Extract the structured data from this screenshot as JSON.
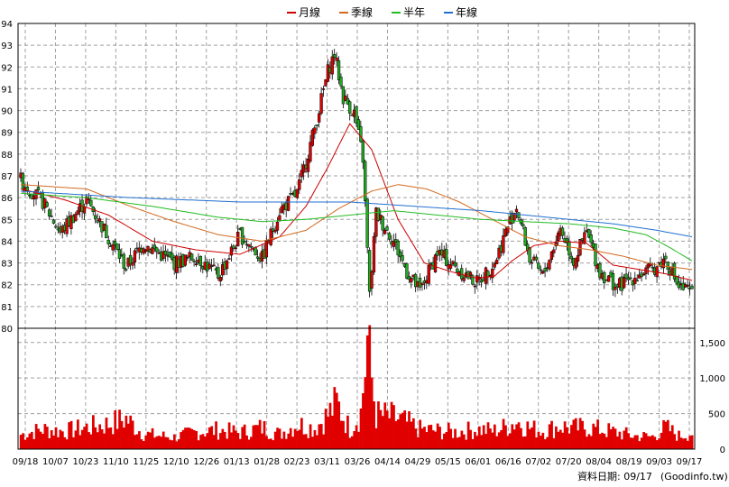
{
  "chart_data": {
    "type": "candlestick",
    "legend": [
      {
        "name": "月線",
        "color": "#cc0000"
      },
      {
        "name": "季線",
        "color": "#d2691e"
      },
      {
        "name": "半年",
        "color": "#22bb22"
      },
      {
        "name": "年線",
        "color": "#1f6fd0"
      }
    ],
    "legend_placement": "top-center",
    "grid": true,
    "price_axis": {
      "min": 80,
      "max": 94,
      "ticks": [
        "80",
        "81",
        "82",
        "83",
        "84",
        "85",
        "86",
        "87",
        "88",
        "89",
        "90",
        "91",
        "92",
        "93",
        "94"
      ]
    },
    "volume_axis": {
      "min": 0,
      "max": 1700,
      "ticks": [
        "0",
        "500",
        "1,000",
        "1,500"
      ]
    },
    "x_tick_labels": [
      "09/18",
      "10/07",
      "10/23",
      "11/10",
      "11/25",
      "12/10",
      "12/26",
      "01/13",
      "01/28",
      "02/23",
      "03/11",
      "03/26",
      "04/14",
      "04/29",
      "05/15",
      "06/01",
      "06/16",
      "07/02",
      "07/20",
      "08/04",
      "08/19",
      "09/03",
      "09/17"
    ],
    "up_color": "#dd0000",
    "down_color": "#22aa22",
    "price_anchors": [
      [
        0,
        86.8
      ],
      [
        10,
        85.8
      ],
      [
        18,
        84.4
      ],
      [
        30,
        85.9
      ],
      [
        40,
        84.2
      ],
      [
        48,
        82.8
      ],
      [
        56,
        83.9
      ],
      [
        70,
        83.0
      ],
      [
        80,
        83.3
      ],
      [
        90,
        82.4
      ],
      [
        100,
        84.3
      ],
      [
        110,
        83.2
      ],
      [
        118,
        85.4
      ],
      [
        126,
        86.2
      ],
      [
        134,
        89.2
      ],
      [
        140,
        91.8
      ],
      [
        143,
        92.6
      ],
      [
        147,
        90.6
      ],
      [
        152,
        89.9
      ],
      [
        156,
        87.8
      ],
      [
        159,
        81.5
      ],
      [
        162,
        85.3
      ],
      [
        170,
        84.0
      ],
      [
        176,
        82.6
      ],
      [
        182,
        81.7
      ],
      [
        190,
        83.5
      ],
      [
        198,
        82.8
      ],
      [
        208,
        82.1
      ],
      [
        216,
        83.0
      ],
      [
        222,
        84.7
      ],
      [
        226,
        85.6
      ],
      [
        232,
        83.2
      ],
      [
        238,
        82.4
      ],
      [
        246,
        84.6
      ],
      [
        252,
        83.1
      ],
      [
        258,
        84.4
      ],
      [
        264,
        82.6
      ],
      [
        272,
        81.9
      ],
      [
        280,
        82.4
      ],
      [
        288,
        82.7
      ],
      [
        294,
        83.2
      ],
      [
        300,
        81.9
      ],
      [
        306,
        81.6
      ]
    ],
    "ma_anchors": {
      "月線": [
        [
          0,
          86.4
        ],
        [
          20,
          85.9
        ],
        [
          40,
          85.2
        ],
        [
          60,
          84.0
        ],
        [
          80,
          83.6
        ],
        [
          100,
          83.4
        ],
        [
          118,
          84.2
        ],
        [
          130,
          85.6
        ],
        [
          140,
          87.4
        ],
        [
          150,
          89.4
        ],
        [
          160,
          88.2
        ],
        [
          172,
          85.0
        ],
        [
          184,
          83.0
        ],
        [
          196,
          82.6
        ],
        [
          208,
          82.3
        ],
        [
          216,
          82.4
        ],
        [
          224,
          83.1
        ],
        [
          234,
          83.8
        ],
        [
          246,
          84.0
        ],
        [
          258,
          83.9
        ],
        [
          270,
          82.9
        ],
        [
          282,
          82.7
        ],
        [
          294,
          82.5
        ],
        [
          306,
          82.2
        ]
      ],
      "季線": [
        [
          0,
          86.6
        ],
        [
          30,
          86.4
        ],
        [
          50,
          85.6
        ],
        [
          70,
          84.9
        ],
        [
          90,
          84.3
        ],
        [
          110,
          84.0
        ],
        [
          130,
          84.5
        ],
        [
          145,
          85.5
        ],
        [
          160,
          86.3
        ],
        [
          172,
          86.6
        ],
        [
          185,
          86.4
        ],
        [
          200,
          85.8
        ],
        [
          215,
          85.0
        ],
        [
          230,
          84.2
        ],
        [
          245,
          83.8
        ],
        [
          260,
          83.6
        ],
        [
          275,
          83.3
        ],
        [
          290,
          82.9
        ],
        [
          306,
          82.7
        ]
      ],
      "半年": [
        [
          0,
          86.2
        ],
        [
          30,
          86.0
        ],
        [
          60,
          85.6
        ],
        [
          90,
          85.1
        ],
        [
          110,
          84.9
        ],
        [
          130,
          85.0
        ],
        [
          150,
          85.2
        ],
        [
          170,
          85.4
        ],
        [
          190,
          85.2
        ],
        [
          210,
          85.0
        ],
        [
          230,
          84.9
        ],
        [
          250,
          84.8
        ],
        [
          270,
          84.6
        ],
        [
          285,
          84.3
        ],
        [
          296,
          83.7
        ],
        [
          306,
          83.1
        ]
      ],
      "年線": [
        [
          0,
          86.3
        ],
        [
          50,
          86.0
        ],
        [
          100,
          85.8
        ],
        [
          150,
          85.8
        ],
        [
          180,
          85.6
        ],
        [
          210,
          85.4
        ],
        [
          240,
          85.1
        ],
        [
          270,
          84.8
        ],
        [
          290,
          84.5
        ],
        [
          306,
          84.2
        ]
      ]
    },
    "volume_anchors": [
      [
        0,
        220
      ],
      [
        10,
        300
      ],
      [
        20,
        270
      ],
      [
        30,
        330
      ],
      [
        40,
        380
      ],
      [
        48,
        460
      ],
      [
        56,
        230
      ],
      [
        70,
        180
      ],
      [
        80,
        260
      ],
      [
        90,
        290
      ],
      [
        100,
        250
      ],
      [
        110,
        330
      ],
      [
        118,
        230
      ],
      [
        126,
        380
      ],
      [
        134,
        320
      ],
      [
        140,
        520
      ],
      [
        144,
        700
      ],
      [
        150,
        300
      ],
      [
        155,
        560
      ],
      [
        158,
        1600
      ],
      [
        162,
        520
      ],
      [
        170,
        480
      ],
      [
        176,
        400
      ],
      [
        182,
        300
      ],
      [
        190,
        280
      ],
      [
        198,
        260
      ],
      [
        208,
        300
      ],
      [
        216,
        280
      ],
      [
        222,
        350
      ],
      [
        226,
        420
      ],
      [
        232,
        320
      ],
      [
        238,
        280
      ],
      [
        246,
        350
      ],
      [
        252,
        320
      ],
      [
        258,
        330
      ],
      [
        264,
        300
      ],
      [
        272,
        250
      ],
      [
        280,
        200
      ],
      [
        288,
        190
      ],
      [
        294,
        330
      ],
      [
        300,
        200
      ],
      [
        306,
        250
      ]
    ]
  },
  "footer": {
    "date_label": "資料日期: 09/17",
    "source": "(Goodinfo.tw)"
  }
}
